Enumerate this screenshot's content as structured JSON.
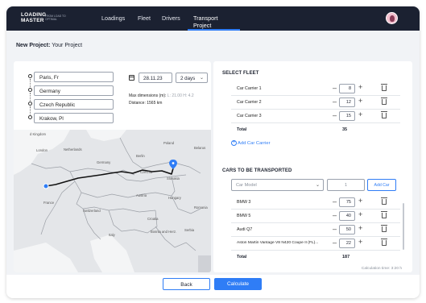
{
  "app": {
    "logo_line1": "LOADING",
    "logo_line2": "MASTER",
    "logo_tagline": "FROM LOAD TO OPTIMAL"
  },
  "nav": {
    "items": [
      {
        "label": "Loadings"
      },
      {
        "label": "Fleet"
      },
      {
        "label": "Drivers"
      },
      {
        "label": "Transport Project",
        "active": true
      }
    ]
  },
  "page": {
    "title_prefix": "New Project:",
    "title_name": "Your Project"
  },
  "route": {
    "stops": [
      {
        "value": "Paris, Fr"
      },
      {
        "value": "Germany"
      },
      {
        "value": "Czech Republic"
      },
      {
        "value": "Krakow,  Pl"
      }
    ],
    "date": "28.11.23",
    "duration": "2 days",
    "max_dimensions_label": "Max dimensions (m):",
    "max_dimensions_value": "L: 21.00 H: 4.2",
    "distance_label": "Distance:",
    "distance_value": "1565 km"
  },
  "map": {
    "labels": {
      "kingdom": "d Kingdom",
      "london": "London",
      "netherlands": "Netherlands",
      "germany": "Germany",
      "poland": "Poland",
      "czechia": "Czechia",
      "slovakia": "Slovakia",
      "france": "France",
      "austria": "Austria",
      "hungary": "Hungary",
      "romania": "Romania",
      "italy": "Italy",
      "serbia": "Serbia",
      "croatia": "Croatia",
      "bosnia": "Bosnia and Herz.",
      "switzerland": "Switzerland",
      "berlin": "Berlin",
      "belarus": "Belarus"
    }
  },
  "fleet": {
    "title": "SELECT FLEET",
    "items": [
      {
        "label": "Car Carrier 1",
        "qty": "8"
      },
      {
        "label": "Car Carrier 2",
        "qty": "12"
      },
      {
        "label": "Car Carrier 3",
        "qty": "15"
      }
    ],
    "total_label": "Total",
    "total_value": "35",
    "add_label": "Add Car Carrier"
  },
  "cars": {
    "title": "CARS TO BE TRANSPORTED",
    "model_placeholder": "Car Model",
    "count_value": "1",
    "add_button": "Add Car",
    "items": [
      {
        "label": "BMW 3",
        "qty": "75"
      },
      {
        "label": "BMW 5",
        "qty": "40"
      },
      {
        "label": "Audi Q7",
        "qty": "50"
      },
      {
        "label": "Aston Martin Vantage V8 N420 Coupe II (FL)...",
        "qty": "22"
      }
    ],
    "total_label": "Total",
    "total_value": "187",
    "calc_time": "Calculation time: 3:20 h"
  },
  "footer": {
    "back_label": "Back",
    "calculate_label": "Calculate"
  },
  "colors": {
    "topbar": "#1b2131",
    "accent": "#2f7df6",
    "background": "#f1f3f6"
  }
}
